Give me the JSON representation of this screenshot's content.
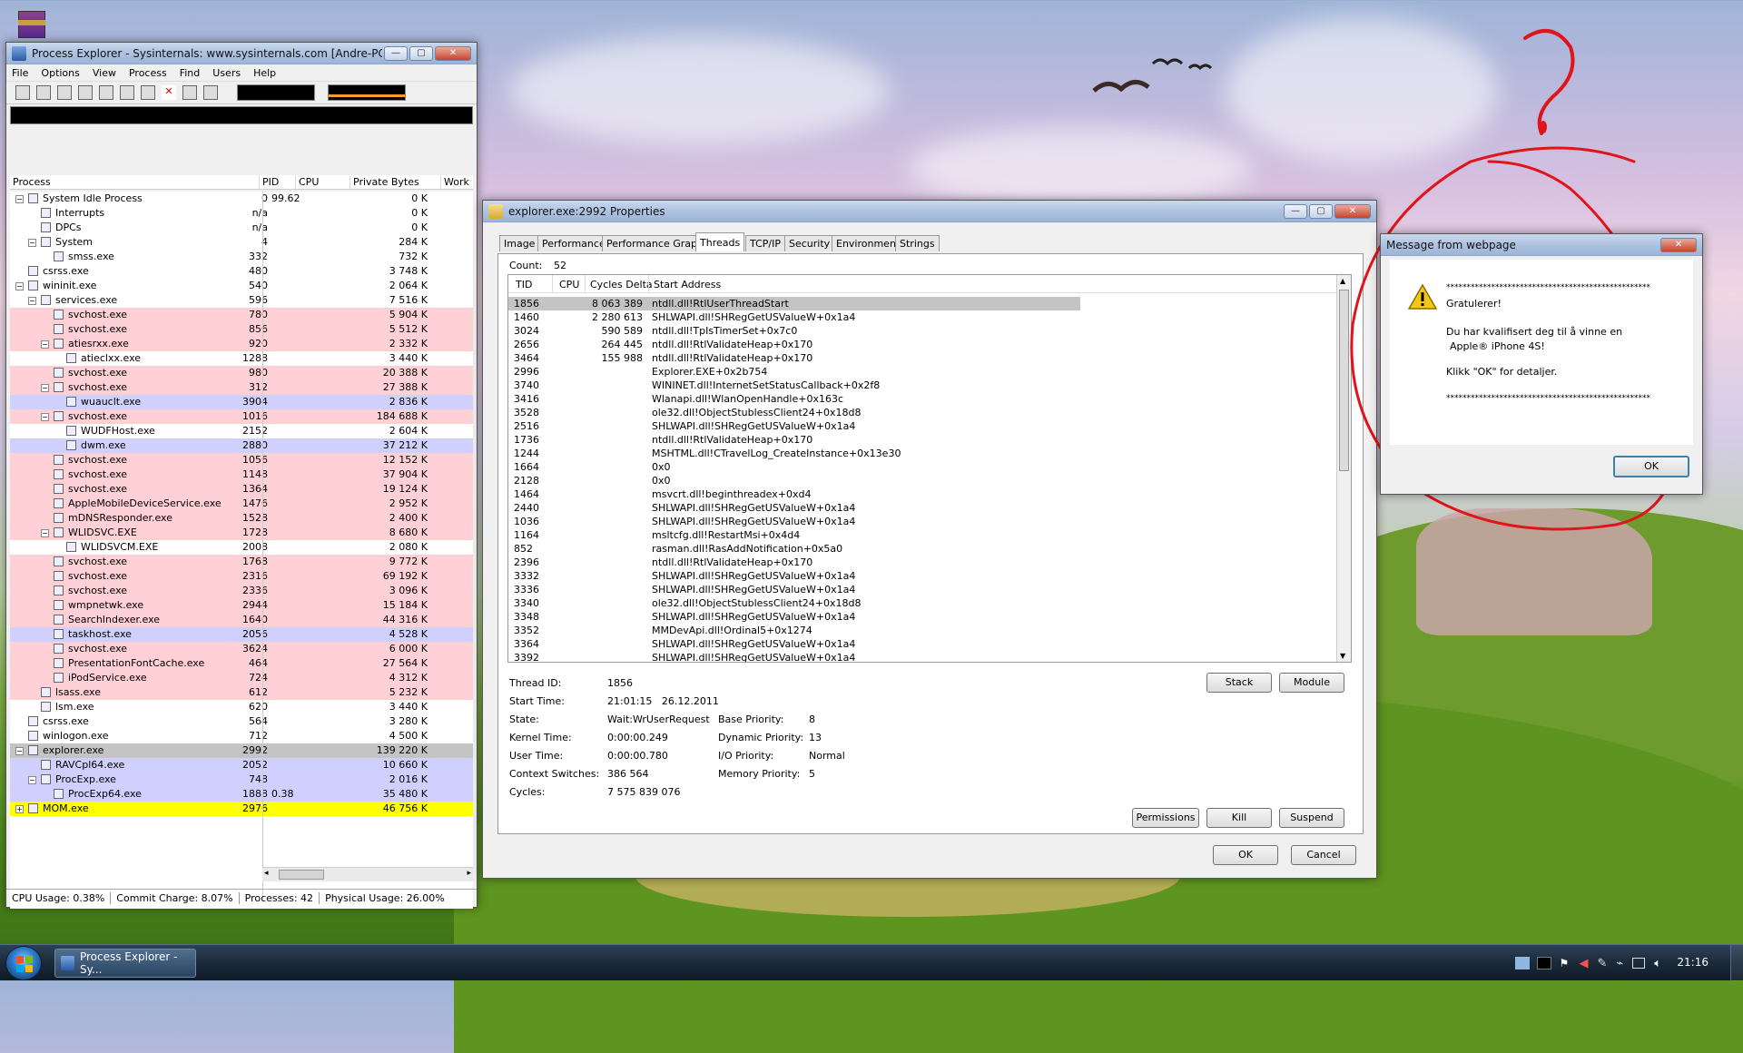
{
  "process_explorer": {
    "title": "Process Explorer - Sysinternals: www.sysinternals.com [Andre-PC\\Andre]",
    "menu": [
      "File",
      "Options",
      "View",
      "Process",
      "Find",
      "Users",
      "Help"
    ],
    "columns": [
      "Process",
      "PID",
      "CPU",
      "Private Bytes",
      "Work"
    ],
    "rows": [
      {
        "name": "System Idle Process",
        "pid": "0",
        "cpu": "99.62",
        "pb": "0 K",
        "depth": 0,
        "exp": "-",
        "color": ""
      },
      {
        "name": "Interrupts",
        "pid": "n/a",
        "cpu": "",
        "pb": "0 K",
        "depth": 1,
        "exp": "",
        "color": ""
      },
      {
        "name": "DPCs",
        "pid": "n/a",
        "cpu": "",
        "pb": "0 K",
        "depth": 1,
        "exp": "",
        "color": ""
      },
      {
        "name": "System",
        "pid": "4",
        "cpu": "",
        "pb": "284 K",
        "depth": 1,
        "exp": "-",
        "color": ""
      },
      {
        "name": "smss.exe",
        "pid": "332",
        "cpu": "",
        "pb": "732 K",
        "depth": 2,
        "exp": "",
        "color": ""
      },
      {
        "name": "csrss.exe",
        "pid": "480",
        "cpu": "",
        "pb": "3 748 K",
        "depth": 0,
        "exp": "",
        "color": ""
      },
      {
        "name": "wininit.exe",
        "pid": "540",
        "cpu": "",
        "pb": "2 064 K",
        "depth": 0,
        "exp": "-",
        "color": ""
      },
      {
        "name": "services.exe",
        "pid": "596",
        "cpu": "",
        "pb": "7 516 K",
        "depth": 1,
        "exp": "-",
        "color": ""
      },
      {
        "name": "svchost.exe",
        "pid": "780",
        "cpu": "",
        "pb": "5 904 K",
        "depth": 2,
        "exp": "",
        "color": "pink"
      },
      {
        "name": "svchost.exe",
        "pid": "856",
        "cpu": "",
        "pb": "5 512 K",
        "depth": 2,
        "exp": "",
        "color": "pink"
      },
      {
        "name": "atiesrxx.exe",
        "pid": "920",
        "cpu": "",
        "pb": "2 332 K",
        "depth": 2,
        "exp": "-",
        "color": "pink"
      },
      {
        "name": "atieclxx.exe",
        "pid": "1288",
        "cpu": "",
        "pb": "3 440 K",
        "depth": 3,
        "exp": "",
        "color": ""
      },
      {
        "name": "svchost.exe",
        "pid": "980",
        "cpu": "",
        "pb": "20 388 K",
        "depth": 2,
        "exp": "",
        "color": "pink"
      },
      {
        "name": "svchost.exe",
        "pid": "312",
        "cpu": "",
        "pb": "27 388 K",
        "depth": 2,
        "exp": "-",
        "color": "pink"
      },
      {
        "name": "wuauclt.exe",
        "pid": "3904",
        "cpu": "",
        "pb": "2 836 K",
        "depth": 3,
        "exp": "",
        "color": "blue"
      },
      {
        "name": "svchost.exe",
        "pid": "1016",
        "cpu": "",
        "pb": "184 688 K",
        "depth": 2,
        "exp": "-",
        "color": "pink"
      },
      {
        "name": "WUDFHost.exe",
        "pid": "2152",
        "cpu": "",
        "pb": "2 604 K",
        "depth": 3,
        "exp": "",
        "color": ""
      },
      {
        "name": "dwm.exe",
        "pid": "2880",
        "cpu": "",
        "pb": "37 212 K",
        "depth": 3,
        "exp": "",
        "color": "blue"
      },
      {
        "name": "svchost.exe",
        "pid": "1056",
        "cpu": "",
        "pb": "12 152 K",
        "depth": 2,
        "exp": "",
        "color": "pink"
      },
      {
        "name": "svchost.exe",
        "pid": "1148",
        "cpu": "",
        "pb": "37 904 K",
        "depth": 2,
        "exp": "",
        "color": "pink"
      },
      {
        "name": "svchost.exe",
        "pid": "1364",
        "cpu": "",
        "pb": "19 124 K",
        "depth": 2,
        "exp": "",
        "color": "pink"
      },
      {
        "name": "AppleMobileDeviceService.exe",
        "pid": "1476",
        "cpu": "",
        "pb": "2 952 K",
        "depth": 2,
        "exp": "",
        "color": "pink"
      },
      {
        "name": "mDNSResponder.exe",
        "pid": "1528",
        "cpu": "",
        "pb": "2 400 K",
        "depth": 2,
        "exp": "",
        "color": "pink"
      },
      {
        "name": "WLIDSVC.EXE",
        "pid": "1728",
        "cpu": "",
        "pb": "8 680 K",
        "depth": 2,
        "exp": "-",
        "color": "pink"
      },
      {
        "name": "WLIDSVCM.EXE",
        "pid": "2008",
        "cpu": "",
        "pb": "2 080 K",
        "depth": 3,
        "exp": "",
        "color": ""
      },
      {
        "name": "svchost.exe",
        "pid": "1768",
        "cpu": "",
        "pb": "9 772 K",
        "depth": 2,
        "exp": "",
        "color": "pink"
      },
      {
        "name": "svchost.exe",
        "pid": "2316",
        "cpu": "",
        "pb": "69 192 K",
        "depth": 2,
        "exp": "",
        "color": "pink"
      },
      {
        "name": "svchost.exe",
        "pid": "2336",
        "cpu": "",
        "pb": "3 096 K",
        "depth": 2,
        "exp": "",
        "color": "pink"
      },
      {
        "name": "wmpnetwk.exe",
        "pid": "2944",
        "cpu": "",
        "pb": "15 184 K",
        "depth": 2,
        "exp": "",
        "color": "pink"
      },
      {
        "name": "SearchIndexer.exe",
        "pid": "1640",
        "cpu": "",
        "pb": "44 316 K",
        "depth": 2,
        "exp": "",
        "color": "pink"
      },
      {
        "name": "taskhost.exe",
        "pid": "2056",
        "cpu": "",
        "pb": "4 528 K",
        "depth": 2,
        "exp": "",
        "color": "blue"
      },
      {
        "name": "svchost.exe",
        "pid": "3624",
        "cpu": "",
        "pb": "6 000 K",
        "depth": 2,
        "exp": "",
        "color": "pink"
      },
      {
        "name": "PresentationFontCache.exe",
        "pid": "464",
        "cpu": "",
        "pb": "27 564 K",
        "depth": 2,
        "exp": "",
        "color": "pink"
      },
      {
        "name": "iPodService.exe",
        "pid": "724",
        "cpu": "",
        "pb": "4 312 K",
        "depth": 2,
        "exp": "",
        "color": "pink"
      },
      {
        "name": "lsass.exe",
        "pid": "612",
        "cpu": "",
        "pb": "5 232 K",
        "depth": 1,
        "exp": "",
        "color": "pink"
      },
      {
        "name": "lsm.exe",
        "pid": "620",
        "cpu": "",
        "pb": "3 440 K",
        "depth": 1,
        "exp": "",
        "color": ""
      },
      {
        "name": "csrss.exe",
        "pid": "564",
        "cpu": "",
        "pb": "3 280 K",
        "depth": 0,
        "exp": "",
        "color": ""
      },
      {
        "name": "winlogon.exe",
        "pid": "712",
        "cpu": "",
        "pb": "4 500 K",
        "depth": 0,
        "exp": "",
        "color": ""
      },
      {
        "name": "explorer.exe",
        "pid": "2992",
        "cpu": "",
        "pb": "139 220 K",
        "depth": 0,
        "exp": "-",
        "color": "gray"
      },
      {
        "name": "RAVCpl64.exe",
        "pid": "2052",
        "cpu": "",
        "pb": "10 660 K",
        "depth": 1,
        "exp": "",
        "color": "blue"
      },
      {
        "name": "ProcExp.exe",
        "pid": "748",
        "cpu": "",
        "pb": "2 016 K",
        "depth": 1,
        "exp": "-",
        "color": "blue"
      },
      {
        "name": "ProcExp64.exe",
        "pid": "1888",
        "cpu": "0.38",
        "pb": "35 480 K",
        "depth": 2,
        "exp": "",
        "color": "blue"
      },
      {
        "name": "MOM.exe",
        "pid": "2976",
        "cpu": "",
        "pb": "46 756 K",
        "depth": 0,
        "exp": "+",
        "color": "yellow"
      }
    ],
    "status": {
      "cpu": "CPU Usage: 0.38%",
      "commit": "Commit Charge: 8.07%",
      "processes": "Processes: 42",
      "physical": "Physical Usage: 26.00%"
    }
  },
  "properties": {
    "title": "explorer.exe:2992 Properties",
    "tabs": [
      "Image",
      "Performance",
      "Performance Graph",
      "Threads",
      "TCP/IP",
      "Security",
      "Environment",
      "Strings"
    ],
    "active_tab": "Threads",
    "count_label": "Count:",
    "count_value": "52",
    "columns": [
      "TID",
      "CPU",
      "Cycles Delta",
      "Start Address"
    ],
    "threads": [
      {
        "tid": "1856",
        "cd": "8 063 389",
        "sa": "ntdll.dll!RtlUserThreadStart"
      },
      {
        "tid": "1460",
        "cd": "2 280 613",
        "sa": "SHLWAPI.dll!SHRegGetUSValueW+0x1a4"
      },
      {
        "tid": "3024",
        "cd": "590 589",
        "sa": "ntdll.dll!TpIsTimerSet+0x7c0"
      },
      {
        "tid": "2656",
        "cd": "264 445",
        "sa": "ntdll.dll!RtlValidateHeap+0x170"
      },
      {
        "tid": "3464",
        "cd": "155 988",
        "sa": "ntdll.dll!RtlValidateHeap+0x170"
      },
      {
        "tid": "2996",
        "cd": "",
        "sa": "Explorer.EXE+0x2b754"
      },
      {
        "tid": "3740",
        "cd": "",
        "sa": "WININET.dll!InternetSetStatusCallback+0x2f8"
      },
      {
        "tid": "3416",
        "cd": "",
        "sa": "Wlanapi.dll!WlanOpenHandle+0x163c"
      },
      {
        "tid": "3528",
        "cd": "",
        "sa": "ole32.dll!ObjectStublessClient24+0x18d8"
      },
      {
        "tid": "2516",
        "cd": "",
        "sa": "SHLWAPI.dll!SHRegGetUSValueW+0x1a4"
      },
      {
        "tid": "1736",
        "cd": "",
        "sa": "ntdll.dll!RtlValidateHeap+0x170"
      },
      {
        "tid": "1244",
        "cd": "",
        "sa": "MSHTML.dll!CTravelLog_CreateInstance+0x13e30"
      },
      {
        "tid": "1664",
        "cd": "",
        "sa": "0x0"
      },
      {
        "tid": "2128",
        "cd": "",
        "sa": "0x0"
      },
      {
        "tid": "1464",
        "cd": "",
        "sa": "msvcrt.dll!beginthreadex+0xd4"
      },
      {
        "tid": "2440",
        "cd": "",
        "sa": "SHLWAPI.dll!SHRegGetUSValueW+0x1a4"
      },
      {
        "tid": "1036",
        "cd": "",
        "sa": "SHLWAPI.dll!SHRegGetUSValueW+0x1a4"
      },
      {
        "tid": "1164",
        "cd": "",
        "sa": "msltcfg.dll!RestartMsi+0x4d4"
      },
      {
        "tid": "852",
        "cd": "",
        "sa": "rasman.dll!RasAddNotification+0x5a0"
      },
      {
        "tid": "2396",
        "cd": "",
        "sa": "ntdll.dll!RtlValidateHeap+0x170"
      },
      {
        "tid": "3332",
        "cd": "",
        "sa": "SHLWAPI.dll!SHRegGetUSValueW+0x1a4"
      },
      {
        "tid": "3336",
        "cd": "",
        "sa": "SHLWAPI.dll!SHRegGetUSValueW+0x1a4"
      },
      {
        "tid": "3340",
        "cd": "",
        "sa": "ole32.dll!ObjectStublessClient24+0x18d8"
      },
      {
        "tid": "3348",
        "cd": "",
        "sa": "SHLWAPI.dll!SHRegGetUSValueW+0x1a4"
      },
      {
        "tid": "3352",
        "cd": "",
        "sa": "MMDevApi.dll!Ordinal5+0x1274"
      },
      {
        "tid": "3364",
        "cd": "",
        "sa": "SHLWAPI.dll!SHRegGetUSValueW+0x1a4"
      },
      {
        "tid": "3392",
        "cd": "",
        "sa": "SHLWAPI.dll!SHRegGetUSValueW+0x1a4"
      }
    ],
    "info": {
      "thread_id_label": "Thread ID:",
      "thread_id": "1856",
      "start_time_label": "Start Time:",
      "start_time": "21:01:15   26.12.2011",
      "state_label": "State:",
      "state": "Wait:WrUserRequest",
      "base_priority_label": "Base Priority:",
      "base_priority": "8",
      "kernel_time_label": "Kernel Time:",
      "kernel_time": "0:00:00.249",
      "dynamic_priority_label": "Dynamic Priority:",
      "dynamic_priority": "13",
      "user_time_label": "User Time:",
      "user_time": "0:00:00.780",
      "io_priority_label": "I/O Priority:",
      "io_priority": "Normal",
      "context_switches_label": "Context Switches:",
      "context_switches": "386 564",
      "memory_priority_label": "Memory Priority:",
      "memory_priority": "5",
      "cycles_label": "Cycles:",
      "cycles": "7 575 839 076"
    },
    "buttons": {
      "stack": "Stack",
      "module": "Module",
      "permissions": "Permissions",
      "kill": "Kill",
      "suspend": "Suspend",
      "ok": "OK",
      "cancel": "Cancel"
    }
  },
  "message_box": {
    "title": "Message from webpage",
    "stars": "**************************************************",
    "line1": "Gratulerer!",
    "line2": "Du har kvalifisert deg til å vinne en",
    "line3": "Apple® iPhone 4S!",
    "line4": "Klikk \"OK\" for detaljer.",
    "ok": "OK"
  },
  "taskbar": {
    "task_label": "Process Explorer - Sy...",
    "clock": "21:16"
  },
  "colors": {
    "annotation_red": "#e0151c",
    "pink_row": "#ffd0d6",
    "blue_row": "#d0d0ff",
    "yellow_row": "#ffff00"
  }
}
